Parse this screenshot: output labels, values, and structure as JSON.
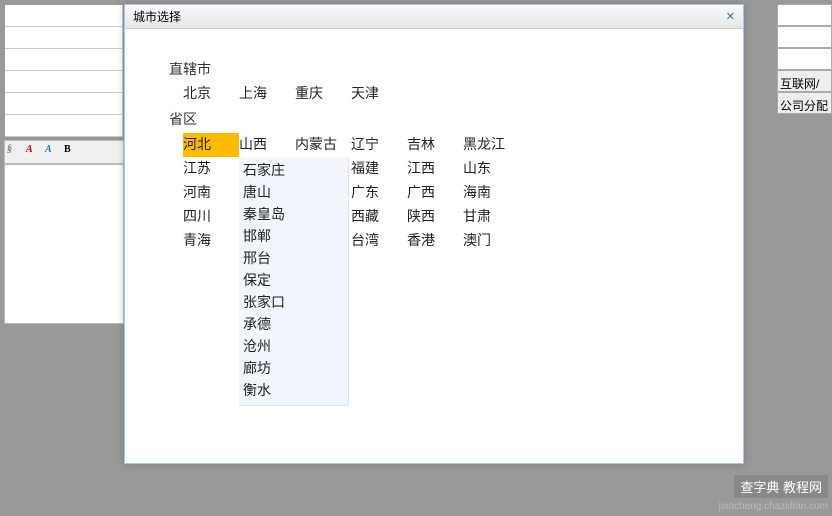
{
  "modal": {
    "title": "城市选择",
    "close": "✕"
  },
  "sections": {
    "muni_label": "直辖市",
    "municipalities": [
      "北京",
      "上海",
      "重庆",
      "天津"
    ],
    "prov_label": "省区",
    "provinces_grid": [
      "河北",
      "山西",
      "内蒙古",
      "辽宁",
      "吉林",
      "黑龙江",
      "江苏",
      "",
      "",
      "福建",
      "江西",
      "山东",
      "河南",
      "",
      "",
      "广东",
      "广西",
      "海南",
      "四川",
      "",
      "",
      "西藏",
      "陕西",
      "甘肃",
      "青海",
      "",
      "",
      "台湾",
      "香港",
      "澳门"
    ],
    "selected": "河北",
    "cities_hebei": [
      "石家庄",
      "唐山",
      "秦皇岛",
      "邯郸",
      "邢台",
      "保定",
      "张家口",
      "承德",
      "沧州",
      "廊坊",
      "衡水"
    ]
  },
  "bg_right": [
    "",
    "",
    "",
    "互联网/",
    "公司分配"
  ],
  "watermark": {
    "line1": "查字典 教程网",
    "line2": "jiaocheng.chazidian.com"
  }
}
